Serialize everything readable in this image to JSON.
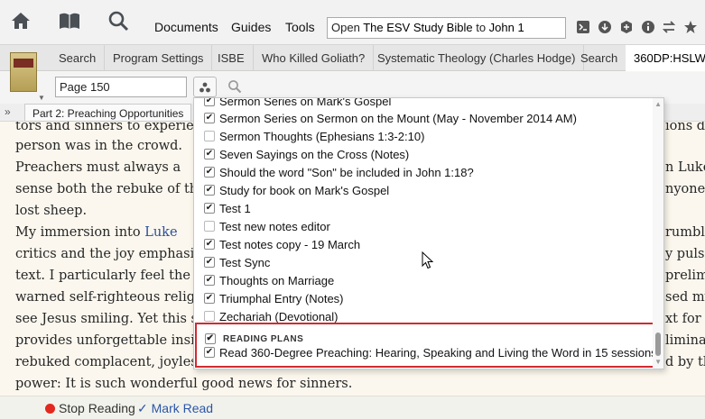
{
  "topbar": {
    "menus": [
      "Documents",
      "Guides",
      "Tools"
    ],
    "go_box_prefix": "Open ",
    "go_box_book": "The ESV Study Bible",
    "go_box_mid": " to ",
    "go_box_ref": "John 1"
  },
  "tabs": [
    "Search",
    "Program Settings",
    "ISBE",
    "Who Killed Goliath?",
    "Systematic Theology (Charles Hodge)",
    "Search",
    "360DP:HSLW"
  ],
  "page_input": "Page 150",
  "breadcrumb": "Part 2: Preaching Opportunities",
  "reader": {
    "lines": [
      "tors and sinners to experien",
      "person was in the crowd.",
      "    Preachers must always a",
      "sense both the rebuke of the",
      "lost sheep.",
      "    My immersion into ",
      "critics and the joy emphasiz",
      "text. I particularly feel the ",
      "warned self-righteous religi",
      "see Jesus smiling. Yet this s",
      "provides unforgettable insi",
      "rebuked complacent, joyless",
      "power: It is such wonderful good news for sinners."
    ],
    "link_word": "Luke",
    "right_fragments": [
      "ions de",
      "n Luke",
      "nyone",
      "rumbl",
      "y pulse",
      "prelim",
      "sed my",
      "xt for a",
      "liminat",
      "d by thi"
    ]
  },
  "bottom": {
    "stop_reading": "Stop Reading",
    "mark_read": "Mark Read"
  },
  "dropdown": {
    "items": [
      {
        "label": "Sermon Series on Mark's Gospel",
        "checked": true
      },
      {
        "label": "Sermon Series on Sermon on the Mount (May - November 2014 AM)",
        "checked": true
      },
      {
        "label": "Sermon Thoughts (Ephesians 1:3-2:10)",
        "checked": false
      },
      {
        "label": "Seven Sayings on the Cross (Notes)",
        "checked": true
      },
      {
        "label": "Should the word \"Son\" be included in John 1:18?",
        "checked": true
      },
      {
        "label": "Study for book on Mark's Gospel",
        "checked": true
      },
      {
        "label": "Test 1",
        "checked": true
      },
      {
        "label": "Test new notes editor",
        "checked": false
      },
      {
        "label": "Test notes copy - 19 March",
        "checked": true
      },
      {
        "label": "Test Sync",
        "checked": true
      },
      {
        "label": "Thoughts on Marriage",
        "checked": true
      },
      {
        "label": "Triumphal Entry (Notes)",
        "checked": true
      },
      {
        "label": "Zechariah (Devotional)",
        "checked": false
      }
    ],
    "section_label": "READING PLANS",
    "section_checked": true,
    "plan_item": "Read 360-Degree Preaching: Hearing, Speaking and Living the Word in 15 sessions",
    "plan_checked": true
  },
  "colors": {
    "highlight_border": "#d22a2f",
    "link": "#2a4f9e",
    "stop_dot": "#e3281f"
  }
}
